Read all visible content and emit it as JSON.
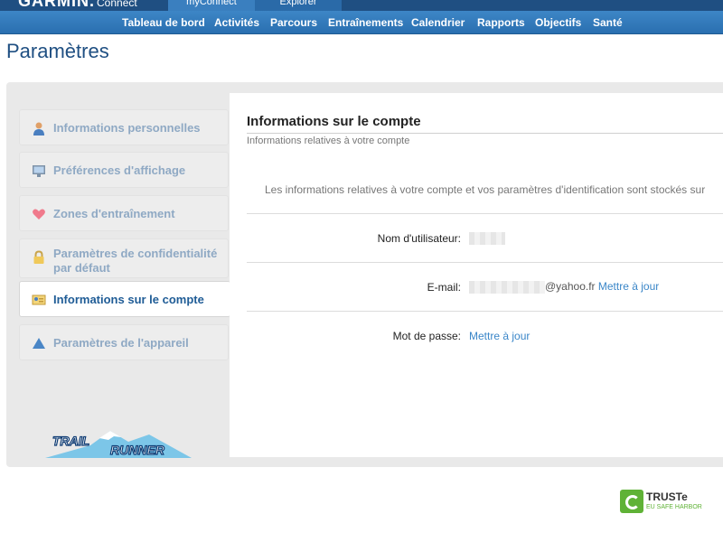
{
  "header": {
    "brand": "GARMIN.",
    "brand_sub": "Connect",
    "tabs": [
      "myConnect",
      "Explorer"
    ]
  },
  "nav": {
    "items": [
      "Tableau de bord",
      "Activités",
      "Parcours",
      "Entraînements",
      "Calendrier",
      "Rapports",
      "Objectifs",
      "Santé"
    ]
  },
  "page": {
    "title": "Paramètres"
  },
  "sidebar": {
    "items": [
      {
        "label": "Informations personnelles",
        "icon": "person-icon"
      },
      {
        "label": "Préférences d'affichage",
        "icon": "monitor-icon"
      },
      {
        "label": "Zones d'entraînement",
        "icon": "heart-icon"
      },
      {
        "label": "Paramètres de confidentialité par défaut",
        "icon": "lock-icon"
      },
      {
        "label": "Informations sur le compte",
        "icon": "id-card-icon",
        "active": true
      },
      {
        "label": "Paramètres de l'appareil",
        "icon": "device-triangle-icon"
      }
    ],
    "logo_text": [
      "TRAIL",
      "RUNNER"
    ]
  },
  "account": {
    "title": "Informations sur le compte",
    "subtitle": "Informations relatives à votre compte",
    "intro": "Les informations relatives à votre compte et vos paramètres d'identification sont stockés sur",
    "rows": [
      {
        "label": "Nom d'utilisateur:"
      },
      {
        "label": "E-mail:",
        "email_suffix": "@yahoo.fr",
        "link": "Mettre à jour"
      },
      {
        "label": "Mot de passe:",
        "link": "Mettre à jour"
      }
    ]
  },
  "footer": {
    "truste": "TRUSTe",
    "truste_sub": "EU SAFE HARBOR"
  },
  "colors": {
    "brand": "#1f4f82",
    "nav": "#2f78b9",
    "link": "#3a86c8",
    "sidebar_text": "#8fa9c4",
    "truste_green": "#5fb236"
  }
}
